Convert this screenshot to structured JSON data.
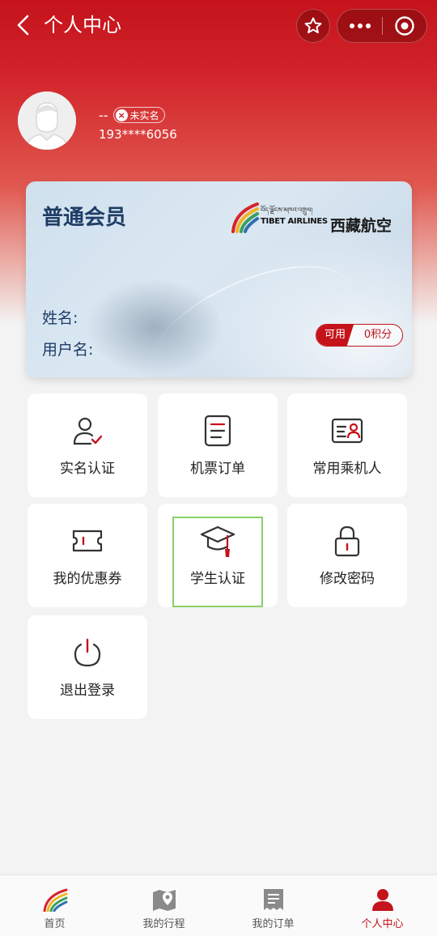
{
  "header": {
    "title": "个人中心",
    "back_icon": "chevron-left-icon",
    "favorite_icon": "star-icon",
    "more_icon": "more-dots-icon",
    "close_icon": "target-circle-icon"
  },
  "profile": {
    "nickname": "--",
    "verify_status": "未实名",
    "phone": "193****6056"
  },
  "member_card": {
    "level": "普通会员",
    "airline_tibetan": "བོད་ལྗོངས་མཁའ་འགྲུལ།",
    "airline_en": "TIBET AIRLINES",
    "airline_cn": "西藏航空",
    "name_label": "姓名:",
    "username_label": "用户名:",
    "available_label": "可用",
    "points": "0积分"
  },
  "menu": [
    {
      "label": "实名认证",
      "icon": "user-check-icon"
    },
    {
      "label": "机票订单",
      "icon": "document-list-icon"
    },
    {
      "label": "常用乘机人",
      "icon": "id-card-icon"
    },
    {
      "label": "我的优惠券",
      "icon": "ticket-icon"
    },
    {
      "label": "学生认证",
      "icon": "graduation-cap-icon"
    },
    {
      "label": "修改密码",
      "icon": "lock-icon"
    },
    {
      "label": "退出登录",
      "icon": "power-icon"
    }
  ],
  "tabbar": [
    {
      "label": "首页",
      "icon": "airline-logo-icon",
      "active": false
    },
    {
      "label": "我的行程",
      "icon": "map-pin-icon",
      "active": false
    },
    {
      "label": "我的订单",
      "icon": "receipt-icon",
      "active": false
    },
    {
      "label": "个人中心",
      "icon": "person-icon",
      "active": true
    }
  ],
  "colors": {
    "brand_red": "#c4131b",
    "card_text": "#1e3d66",
    "highlight_green": "#8ccf6a"
  }
}
